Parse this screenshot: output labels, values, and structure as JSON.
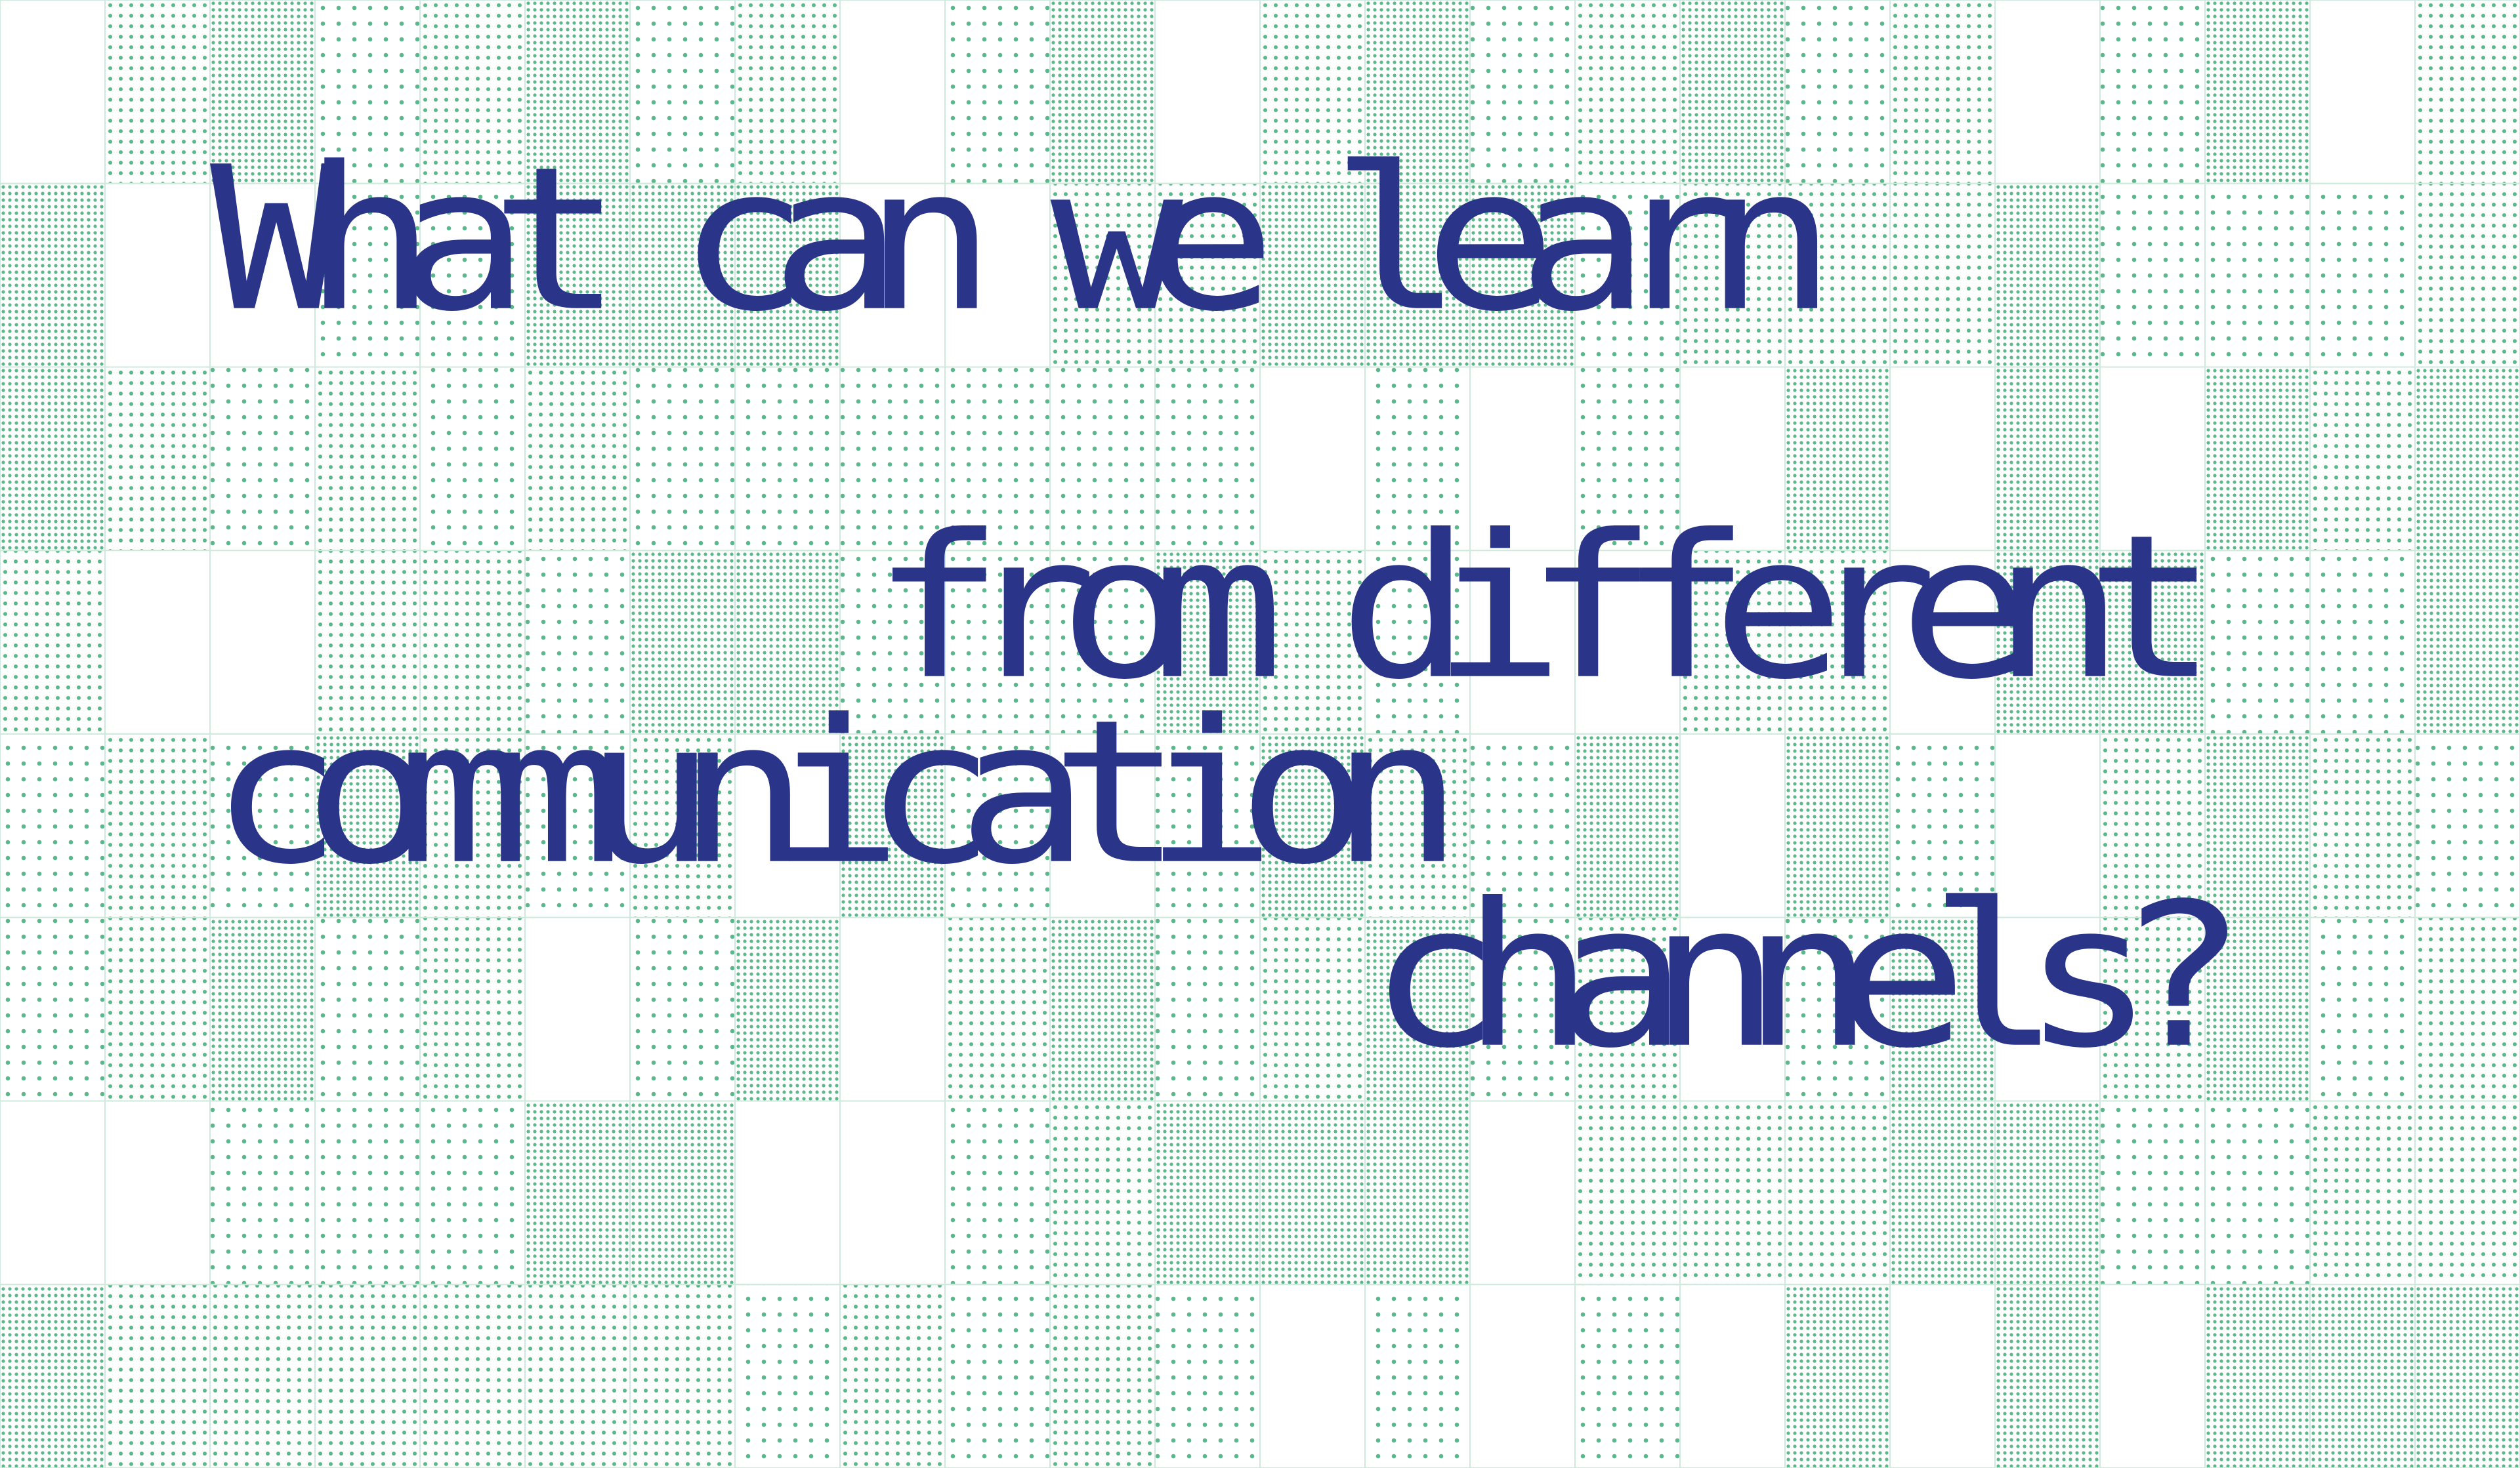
{
  "headline": {
    "line_1": "What can we learn",
    "line_2": "from different",
    "line_3": "communication",
    "line_4": "channels?"
  },
  "colors": {
    "text": "#2a3589",
    "dots": "#5cb88a",
    "grid_lines": "#cfe9dc",
    "background": "#ffffff"
  }
}
